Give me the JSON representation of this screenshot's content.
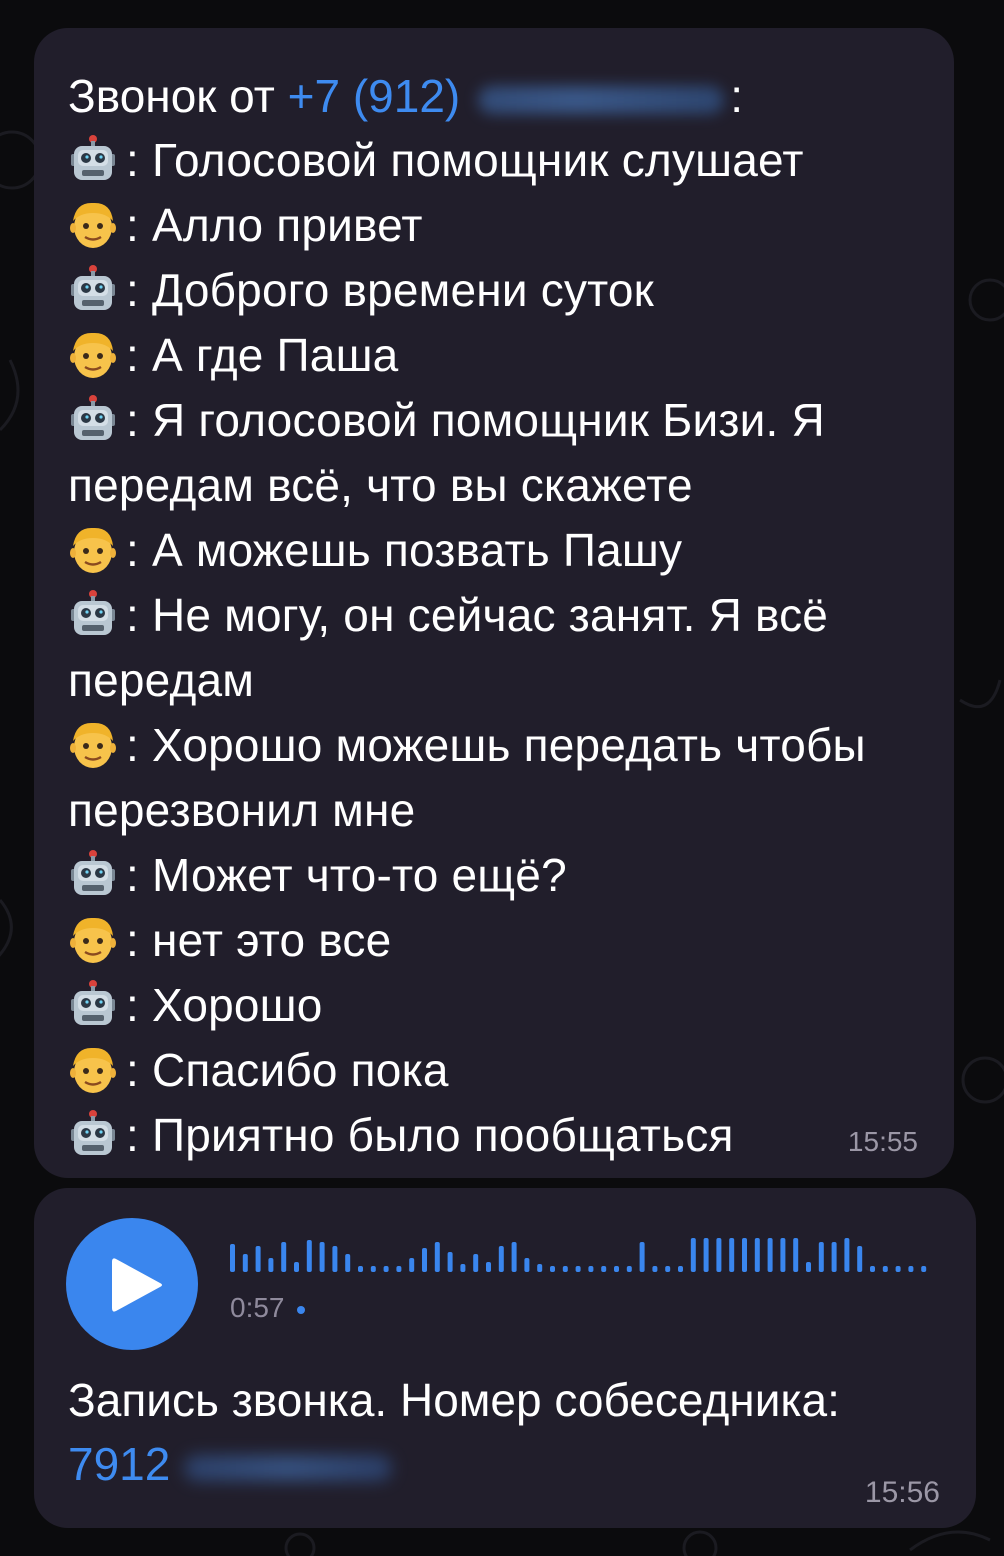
{
  "chat": {
    "message1": {
      "header_prefix": "Звонок от",
      "phone_visible": "+7 (912)",
      "header_suffix": ":",
      "time": "15:55",
      "lines": [
        {
          "speaker": "robot",
          "icon": "robot-face-icon",
          "text": ": Голосовой помощник слушает"
        },
        {
          "speaker": "person",
          "icon": "man-face-icon",
          "text": ": Алло привет"
        },
        {
          "speaker": "robot",
          "icon": "robot-face-icon",
          "text": ": Доброго времени суток"
        },
        {
          "speaker": "person",
          "icon": "man-face-icon",
          "text": ": А где Паша"
        },
        {
          "speaker": "robot",
          "icon": "robot-face-icon",
          "text": ": Я голосовой помощник Бизи. Я передам всё, что вы скажете"
        },
        {
          "speaker": "person",
          "icon": "man-face-icon",
          "text": ": А можешь позвать Пашу"
        },
        {
          "speaker": "robot",
          "icon": "robot-face-icon",
          "text": ": Не могу, он сейчас занят. Я всё передам"
        },
        {
          "speaker": "person",
          "icon": "man-face-icon",
          "text": ": Хорошо можешь передать чтобы перезвонил мне"
        },
        {
          "speaker": "robot",
          "icon": "robot-face-icon",
          "text": ": Может что-то ещё?"
        },
        {
          "speaker": "person",
          "icon": "man-face-icon",
          "text": ": нет это все"
        },
        {
          "speaker": "robot",
          "icon": "robot-face-icon",
          "text": ": Хорошо"
        },
        {
          "speaker": "person",
          "icon": "man-face-icon",
          "text": ": Спасибо пока"
        },
        {
          "speaker": "robot",
          "icon": "robot-face-icon",
          "text": ": Приятно было пообщаться"
        }
      ]
    },
    "message2": {
      "duration": "0:57",
      "caption": "Запись звонка. Номер собеседника:",
      "number_visible": "7912",
      "time": "15:56"
    }
  },
  "colors": {
    "bubble": "#211e2b",
    "link": "#3e8bf0",
    "play_button": "#3a86ee",
    "timestamp": "#9b97a6"
  }
}
